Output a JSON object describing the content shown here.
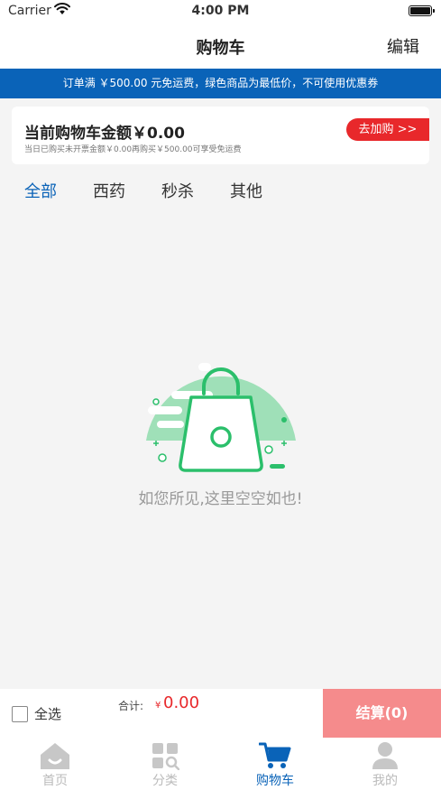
{
  "status_bar": {
    "carrier": "Carrier",
    "time": "4:00 PM"
  },
  "nav": {
    "title": "购物车",
    "edit_label": "编辑"
  },
  "notice": {
    "text": "订单满 ￥500.00 元免运费，绿色商品为最低价，不可使用优惠券"
  },
  "summary": {
    "amount_text": "当前购物车金额￥0.00",
    "sub_text": "当日已购买未开票金额￥0.00再购买￥500.00可享受免运费",
    "go_button": "去加购 >>"
  },
  "tabs": [
    {
      "label": "全部",
      "active": true
    },
    {
      "label": "西药",
      "active": false
    },
    {
      "label": "秒杀",
      "active": false
    },
    {
      "label": "其他",
      "active": false
    }
  ],
  "empty": {
    "message": "如您所见,这里空空如也!"
  },
  "checkout": {
    "select_all_label": "全选",
    "total_label": "合计:",
    "currency_symbol": "¥",
    "total_value": "0.00",
    "checkout_button": "结算(0)"
  },
  "tab_bar": {
    "items": [
      {
        "label": "首页",
        "icon": "home-icon",
        "active": false
      },
      {
        "label": "分类",
        "icon": "category-icon",
        "active": false
      },
      {
        "label": "购物车",
        "icon": "cart-icon",
        "active": true
      },
      {
        "label": "我的",
        "icon": "user-icon",
        "active": false
      }
    ]
  },
  "colors": {
    "primary_blue": "#0a63b8",
    "accent_red": "#e8282b",
    "checkout_pink": "#f58b8c",
    "illustration_green": "#2bbf6b",
    "illustration_light_green": "#9fe0b8"
  }
}
